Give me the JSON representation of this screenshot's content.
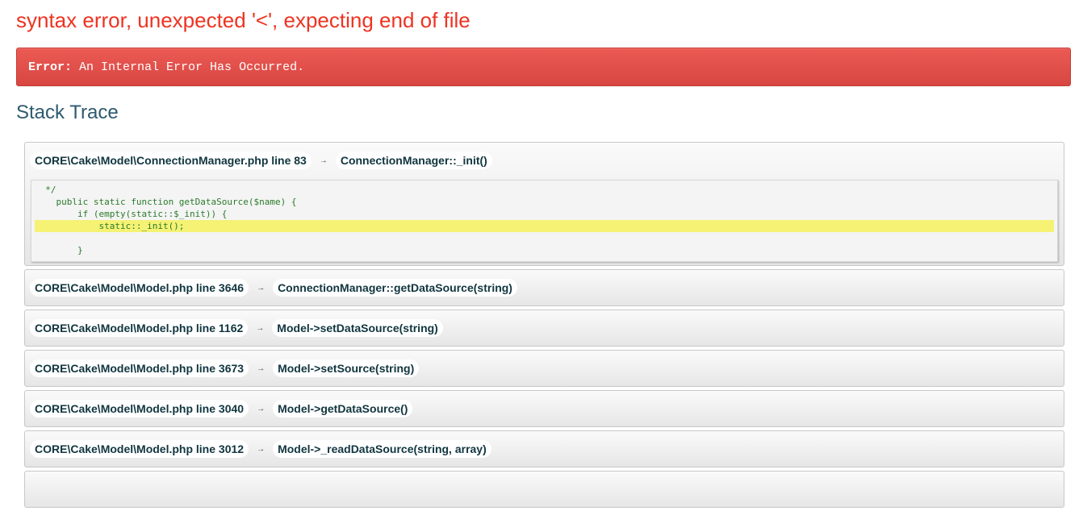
{
  "page": {
    "title": "syntax error, unexpected '<', expecting end of file"
  },
  "error": {
    "label": "Error:",
    "message": "An Internal Error Has Occurred."
  },
  "stack_trace": {
    "heading": "Stack Trace",
    "arrow": "→",
    "frames": [
      {
        "location": "CORE\\Cake\\Model\\ConnectionManager.php line 83",
        "call": "ConnectionManager::_init()"
      },
      {
        "location": "CORE\\Cake\\Model\\Model.php line 3646",
        "call": "ConnectionManager::getDataSource(string)"
      },
      {
        "location": "CORE\\Cake\\Model\\Model.php line 1162",
        "call": "Model->setDataSource(string)"
      },
      {
        "location": "CORE\\Cake\\Model\\Model.php line 3673",
        "call": "Model->setSource(string)"
      },
      {
        "location": "CORE\\Cake\\Model\\Model.php line 3040",
        "call": "Model->getDataSource()"
      },
      {
        "location": "CORE\\Cake\\Model\\Model.php line 3012",
        "call": "Model->_readDataSource(string, array)"
      }
    ],
    "excerpt": {
      "lines": [
        "  */",
        "    public static function getDataSource($name) {",
        "        if (empty(static::$_init)) {",
        "            static::_init();",
        "",
        "        }"
      ],
      "highlight_line": 4
    }
  },
  "colors": {
    "title": "#ee3322",
    "error_bg": "#d84642",
    "heading": "#2d5a6e",
    "highlight": "#f5f274"
  }
}
